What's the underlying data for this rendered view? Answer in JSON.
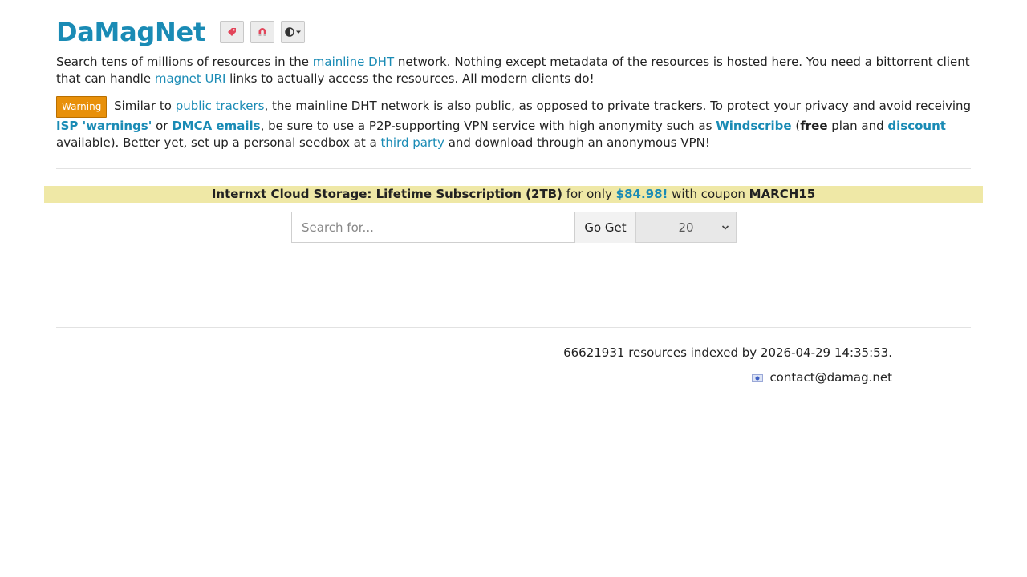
{
  "header": {
    "logo": "DaMagNet",
    "buttons": [
      {
        "icon": "tag-icon",
        "color": "#e2455a"
      },
      {
        "icon": "magnet-icon",
        "color": "#e2455a"
      },
      {
        "icon": "theme-contrast-icon",
        "color": "#333333"
      }
    ]
  },
  "intro": {
    "t1": "Search tens of millions of resources in the ",
    "link_dht": "mainline DHT",
    "t2": " network. Nothing except metadata of the resources is hosted here. You need a bittorrent client that can handle ",
    "link_magnet": "magnet URI",
    "t3": " links to actually access the resources. All modern clients do!"
  },
  "warning": {
    "badge": "Warning",
    "t1": " Similar to ",
    "link_public": "public trackers",
    "t2": ", the mainline DHT network is also public, as opposed to private trackers. To protect your privacy and avoid receiving ",
    "link_isp": "ISP 'warnings'",
    "t3": " or ",
    "link_dmca": "DMCA emails",
    "t4": ", be sure to use a P2P-supporting VPN service with high anonymity such as ",
    "link_windscribe": "Windscribe",
    "t5": " (",
    "free": "free",
    "t6": " plan and ",
    "link_discount": "discount",
    "t7": " available). Better yet, set up a personal seedbox at a ",
    "link_third": "third party",
    "t8": " and download through an anonymous VPN!"
  },
  "promo": {
    "product": "Internxt Cloud Storage: Lifetime Subscription (2TB)",
    "mid": " for only ",
    "price": "$84.98!",
    "mid2": " with coupon ",
    "coupon": "MARCH15",
    "bg_color": "#efe8a6"
  },
  "search": {
    "placeholder": "Search for...",
    "button": "Go Get",
    "count": "20"
  },
  "footer": {
    "stats": "66621931 resources indexed by 2026-04-29 14:35:53.",
    "contact": "contact@damag.net"
  },
  "colors": {
    "link": "#1a8bb5",
    "warning_badge": "#e8900a"
  }
}
